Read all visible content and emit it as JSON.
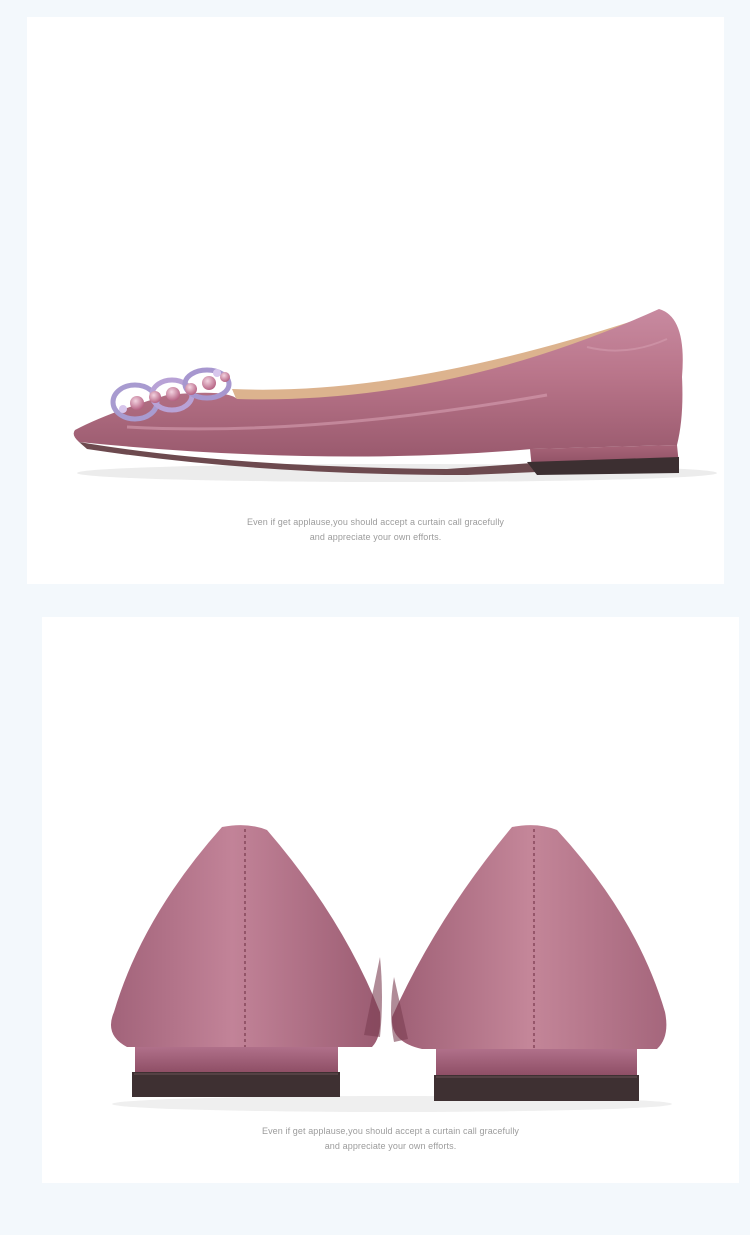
{
  "colors": {
    "page_background": "#f3f8fc",
    "panel_background": "#ffffff",
    "satin": "#b9758a",
    "satin_dark": "#8e4c61",
    "lining": "#dcb38e",
    "sole": "#4a3a3c",
    "caption_text": "#9c9c9c"
  },
  "panels": [
    {
      "view": "side-view",
      "caption_line1": "Even if get applause,you should accept a curtain call gracefully",
      "caption_line2": "and appreciate your own efforts."
    },
    {
      "view": "back-view",
      "caption_line1": "Even if get applause,you should accept a curtain call gracefully",
      "caption_line2": "and appreciate your own efforts."
    }
  ]
}
